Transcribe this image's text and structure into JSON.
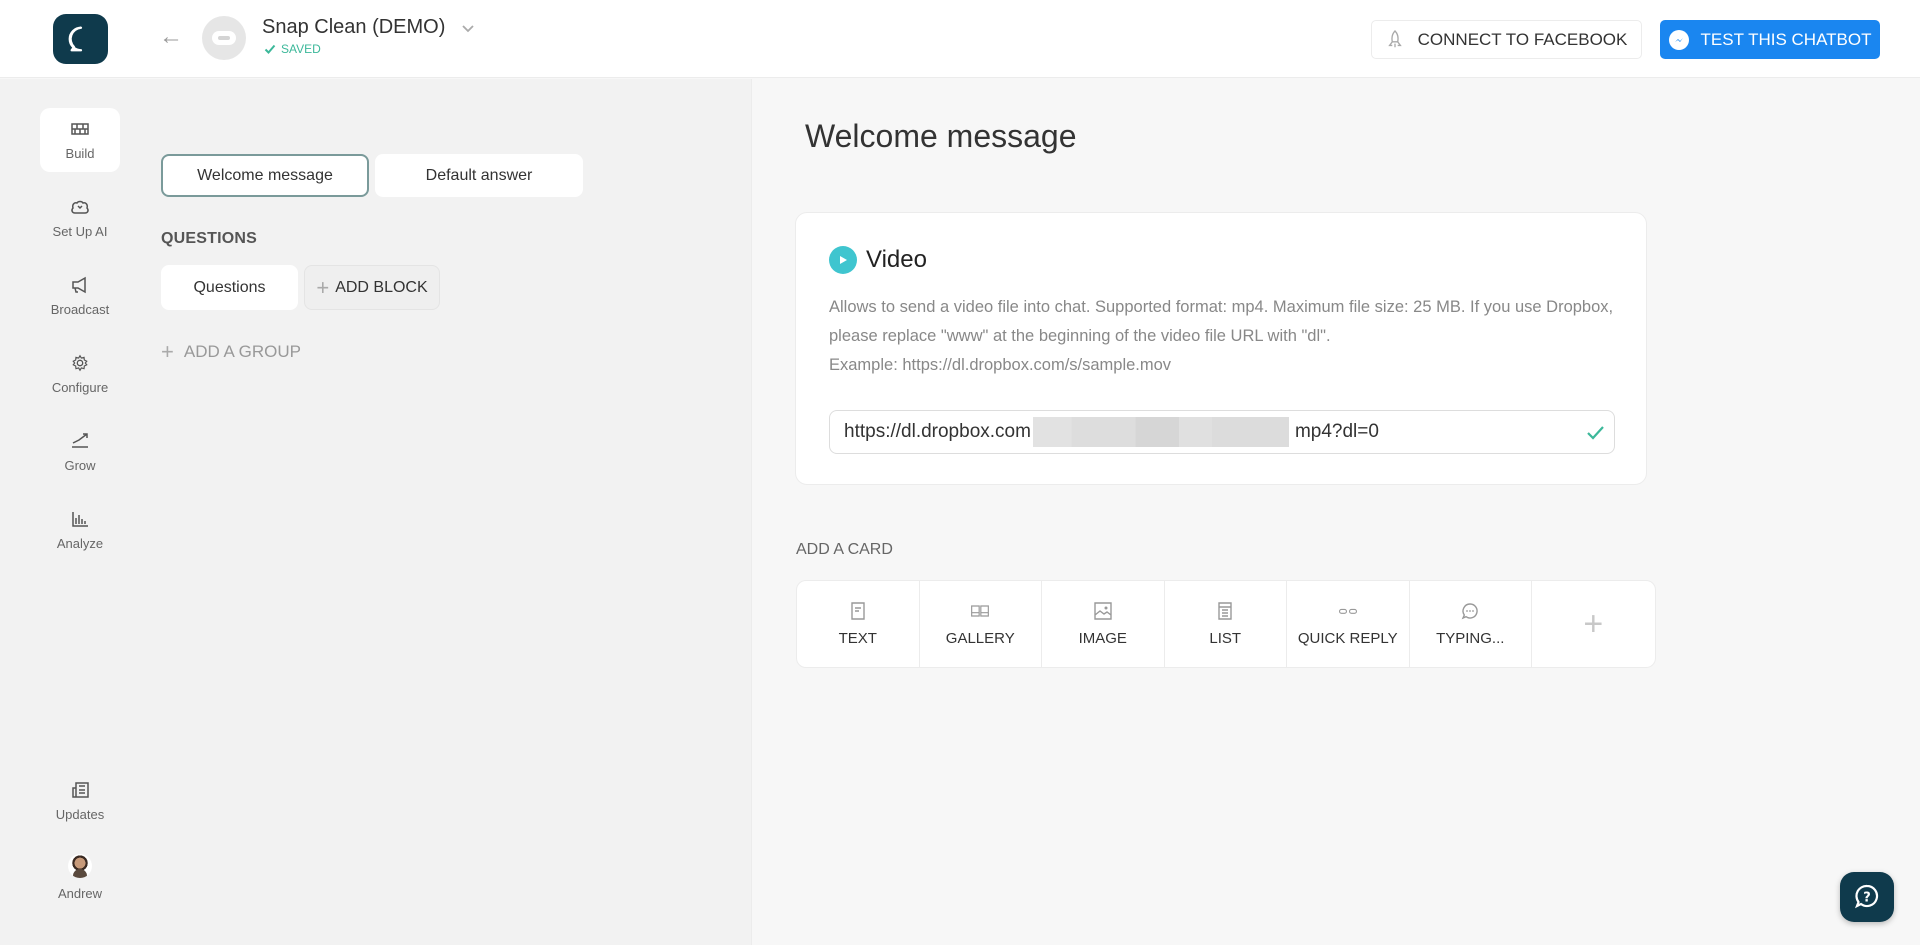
{
  "header": {
    "bot_name": "Snap Clean (DEMO)",
    "save_status": "SAVED",
    "connect_button": "CONNECT TO FACEBOOK",
    "test_button": "TEST THIS CHATBOT"
  },
  "nav": {
    "items": [
      {
        "label": "Build",
        "icon": "bricks-icon",
        "active": true
      },
      {
        "label": "Set Up AI",
        "icon": "brain-icon"
      },
      {
        "label": "Broadcast",
        "icon": "megaphone-icon"
      },
      {
        "label": "Configure",
        "icon": "gear-icon"
      },
      {
        "label": "Grow",
        "icon": "trend-up-icon"
      },
      {
        "label": "Analyze",
        "icon": "bar-chart-icon"
      }
    ],
    "bottom": [
      {
        "label": "Updates",
        "icon": "news-icon"
      },
      {
        "label": "Andrew",
        "icon": "user-avatar"
      }
    ]
  },
  "left_panel": {
    "tabs": [
      {
        "label": "Welcome message",
        "selected": true
      },
      {
        "label": "Default answer",
        "selected": false
      }
    ],
    "questions_label": "QUESTIONS",
    "blocks": [
      {
        "label": "Questions"
      }
    ],
    "add_block": "ADD BLOCK",
    "add_group": "ADD A GROUP"
  },
  "main": {
    "title": "Welcome message",
    "video_card": {
      "title": "Video",
      "description": "Allows to send a video file into chat. Supported format: mp4. Maximum file size: 25 MB. If you use Dropbox, please replace \"www\" at the beginning of the video file URL with \"dl\".",
      "example": "Example: https://dl.dropbox.com/s/sample.mov",
      "url_prefix": "https://dl.dropbox.com",
      "url_suffix": "mp4?dl=0",
      "valid": true
    },
    "add_card_label": "ADD A CARD",
    "card_types": [
      {
        "label": "TEXT",
        "icon": "text-doc-icon"
      },
      {
        "label": "GALLERY",
        "icon": "gallery-icon"
      },
      {
        "label": "IMAGE",
        "icon": "image-icon"
      },
      {
        "label": "LIST",
        "icon": "list-icon"
      },
      {
        "label": "QUICK REPLY",
        "icon": "quick-reply-icon"
      },
      {
        "label": "TYPING...",
        "icon": "typing-icon"
      }
    ]
  },
  "colors": {
    "brand_dark": "#0f3a4c",
    "primary_blue": "#1a86f0",
    "success_green": "#3cb89a",
    "video_teal": "#3fc5cf"
  }
}
